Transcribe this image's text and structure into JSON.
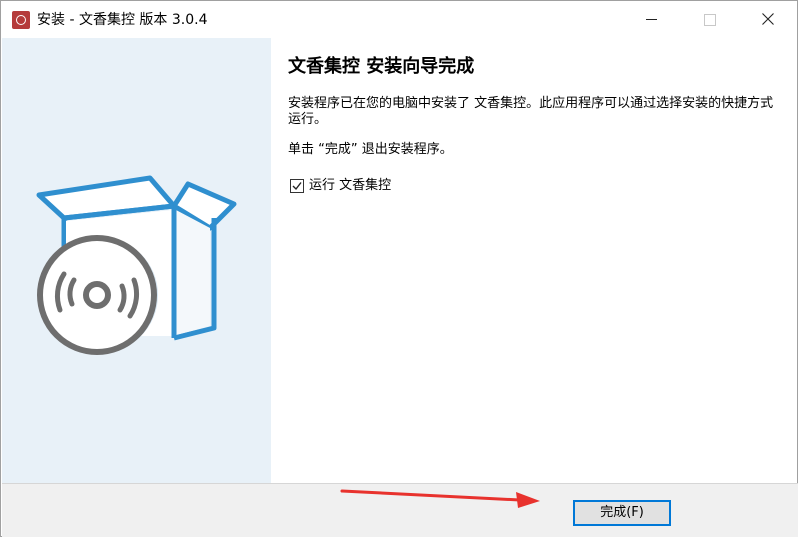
{
  "window": {
    "title": "安装 - 文香集控 版本 3.0.4",
    "app_icon": "installer-app-icon",
    "controls": [
      "minimize-icon",
      "maximize-icon",
      "close-icon"
    ]
  },
  "sidebar": {
    "illustration": "box-with-disc-icon"
  },
  "main": {
    "heading": "文香集控  安装向导完成",
    "description": "安装程序已在您的电脑中安装了 文香集控。此应用程序可以通过选择安装的快捷方式运行。",
    "hint": "单击 “完成” 退出安装程序。",
    "run_checkbox": {
      "label": "运行 文香集控",
      "checked": true
    }
  },
  "footer": {
    "finish_label": "完成(F)"
  },
  "colors": {
    "accent": "#0078d7",
    "illustration_blue": "#2f8fcf",
    "disc_gray": "#6e6e6e",
    "sidebar_bg": "#e8f1f8",
    "annotation_arrow": "#e8322d"
  }
}
